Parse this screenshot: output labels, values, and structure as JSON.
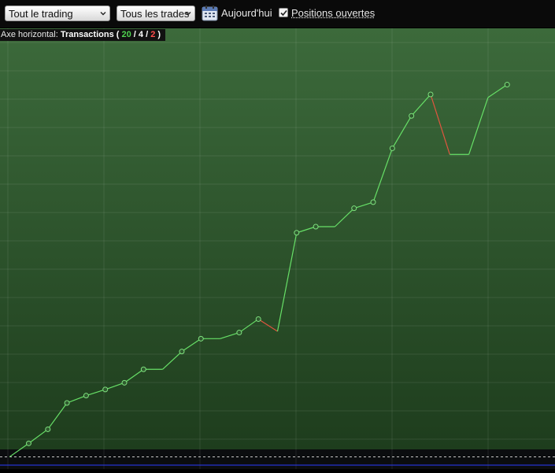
{
  "toolbar": {
    "period_select": "Tout le trading",
    "type_select": "Tous les trades",
    "today_label": "Aujourd'hui",
    "open_positions_label": "Positions ouvertes",
    "open_positions_checked": true
  },
  "axis_tag": {
    "prefix": "Axe horizontal:",
    "mode": "Transactions",
    "open": "(",
    "win_count": "20",
    "sep1": "/",
    "neutral_count": "4",
    "sep2": "/",
    "loss_count": "2",
    "close": ")"
  },
  "colors": {
    "up_line": "#67e067",
    "down_line": "#e0553f",
    "marker": "#7fe07f",
    "baseline": "#c8c8c8",
    "zero_line": "#2b3cff",
    "bg_top": "#3c6a3b",
    "bg_bottom": "#1e3d1d"
  },
  "chart_data": {
    "type": "line",
    "x": [
      0,
      1,
      2,
      3,
      4,
      5,
      6,
      7,
      8,
      9,
      10,
      11,
      12,
      13,
      14,
      15,
      16,
      17,
      18,
      19,
      20,
      21,
      22,
      23,
      24,
      25,
      26
    ],
    "values": [
      0,
      22,
      45,
      88,
      100,
      110,
      121,
      143,
      143,
      172,
      193,
      193,
      203,
      225,
      205,
      366,
      376,
      376,
      406,
      416,
      504,
      557,
      592,
      494,
      494,
      587,
      608
    ],
    "markers": [
      1,
      2,
      3,
      4,
      5,
      6,
      7,
      9,
      10,
      12,
      13,
      15,
      16,
      18,
      19,
      20,
      21,
      22,
      26
    ],
    "ylim": [
      -20,
      700
    ],
    "xlim": [
      -0.5,
      28.5
    ],
    "baseline_value": 0,
    "grid": true
  }
}
